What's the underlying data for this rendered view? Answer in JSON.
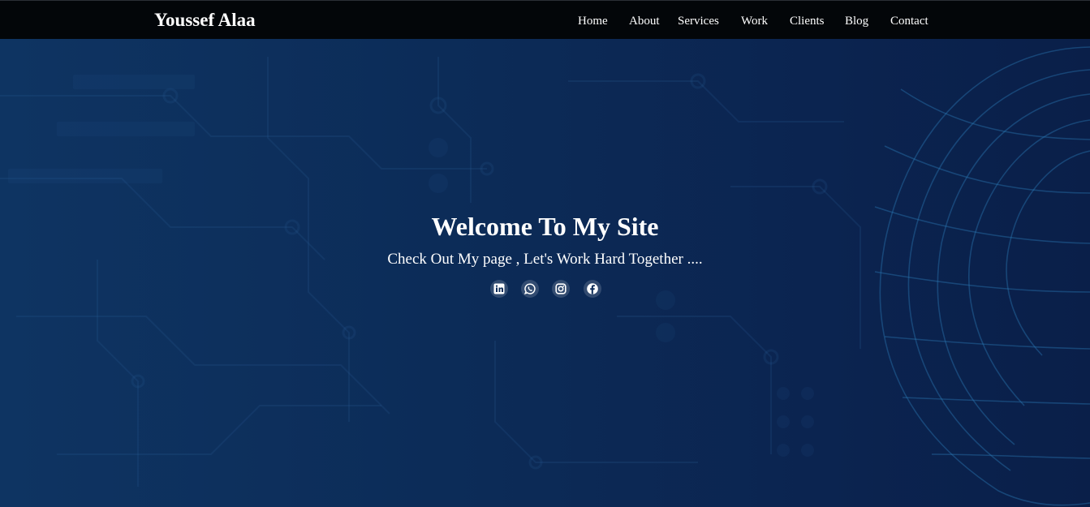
{
  "brand": {
    "name": "Youssef Alaa"
  },
  "nav": {
    "items": [
      {
        "label": "Home"
      },
      {
        "label": "About"
      },
      {
        "label": "Services"
      },
      {
        "label": "Work"
      },
      {
        "label": "Clients"
      },
      {
        "label": "Blog"
      },
      {
        "label": "Contact"
      }
    ]
  },
  "hero": {
    "title": "Welcome To My Site",
    "subtitle": "Check Out My page , Let's Work Hard Together ...."
  },
  "social": {
    "items": [
      {
        "icon": "linkedin-icon"
      },
      {
        "icon": "whatsapp-icon"
      },
      {
        "icon": "instagram-icon"
      },
      {
        "icon": "facebook-icon"
      }
    ]
  },
  "colors": {
    "navbar": "#030609",
    "hero_background": "#0c2b57",
    "text": "#ffffff"
  }
}
